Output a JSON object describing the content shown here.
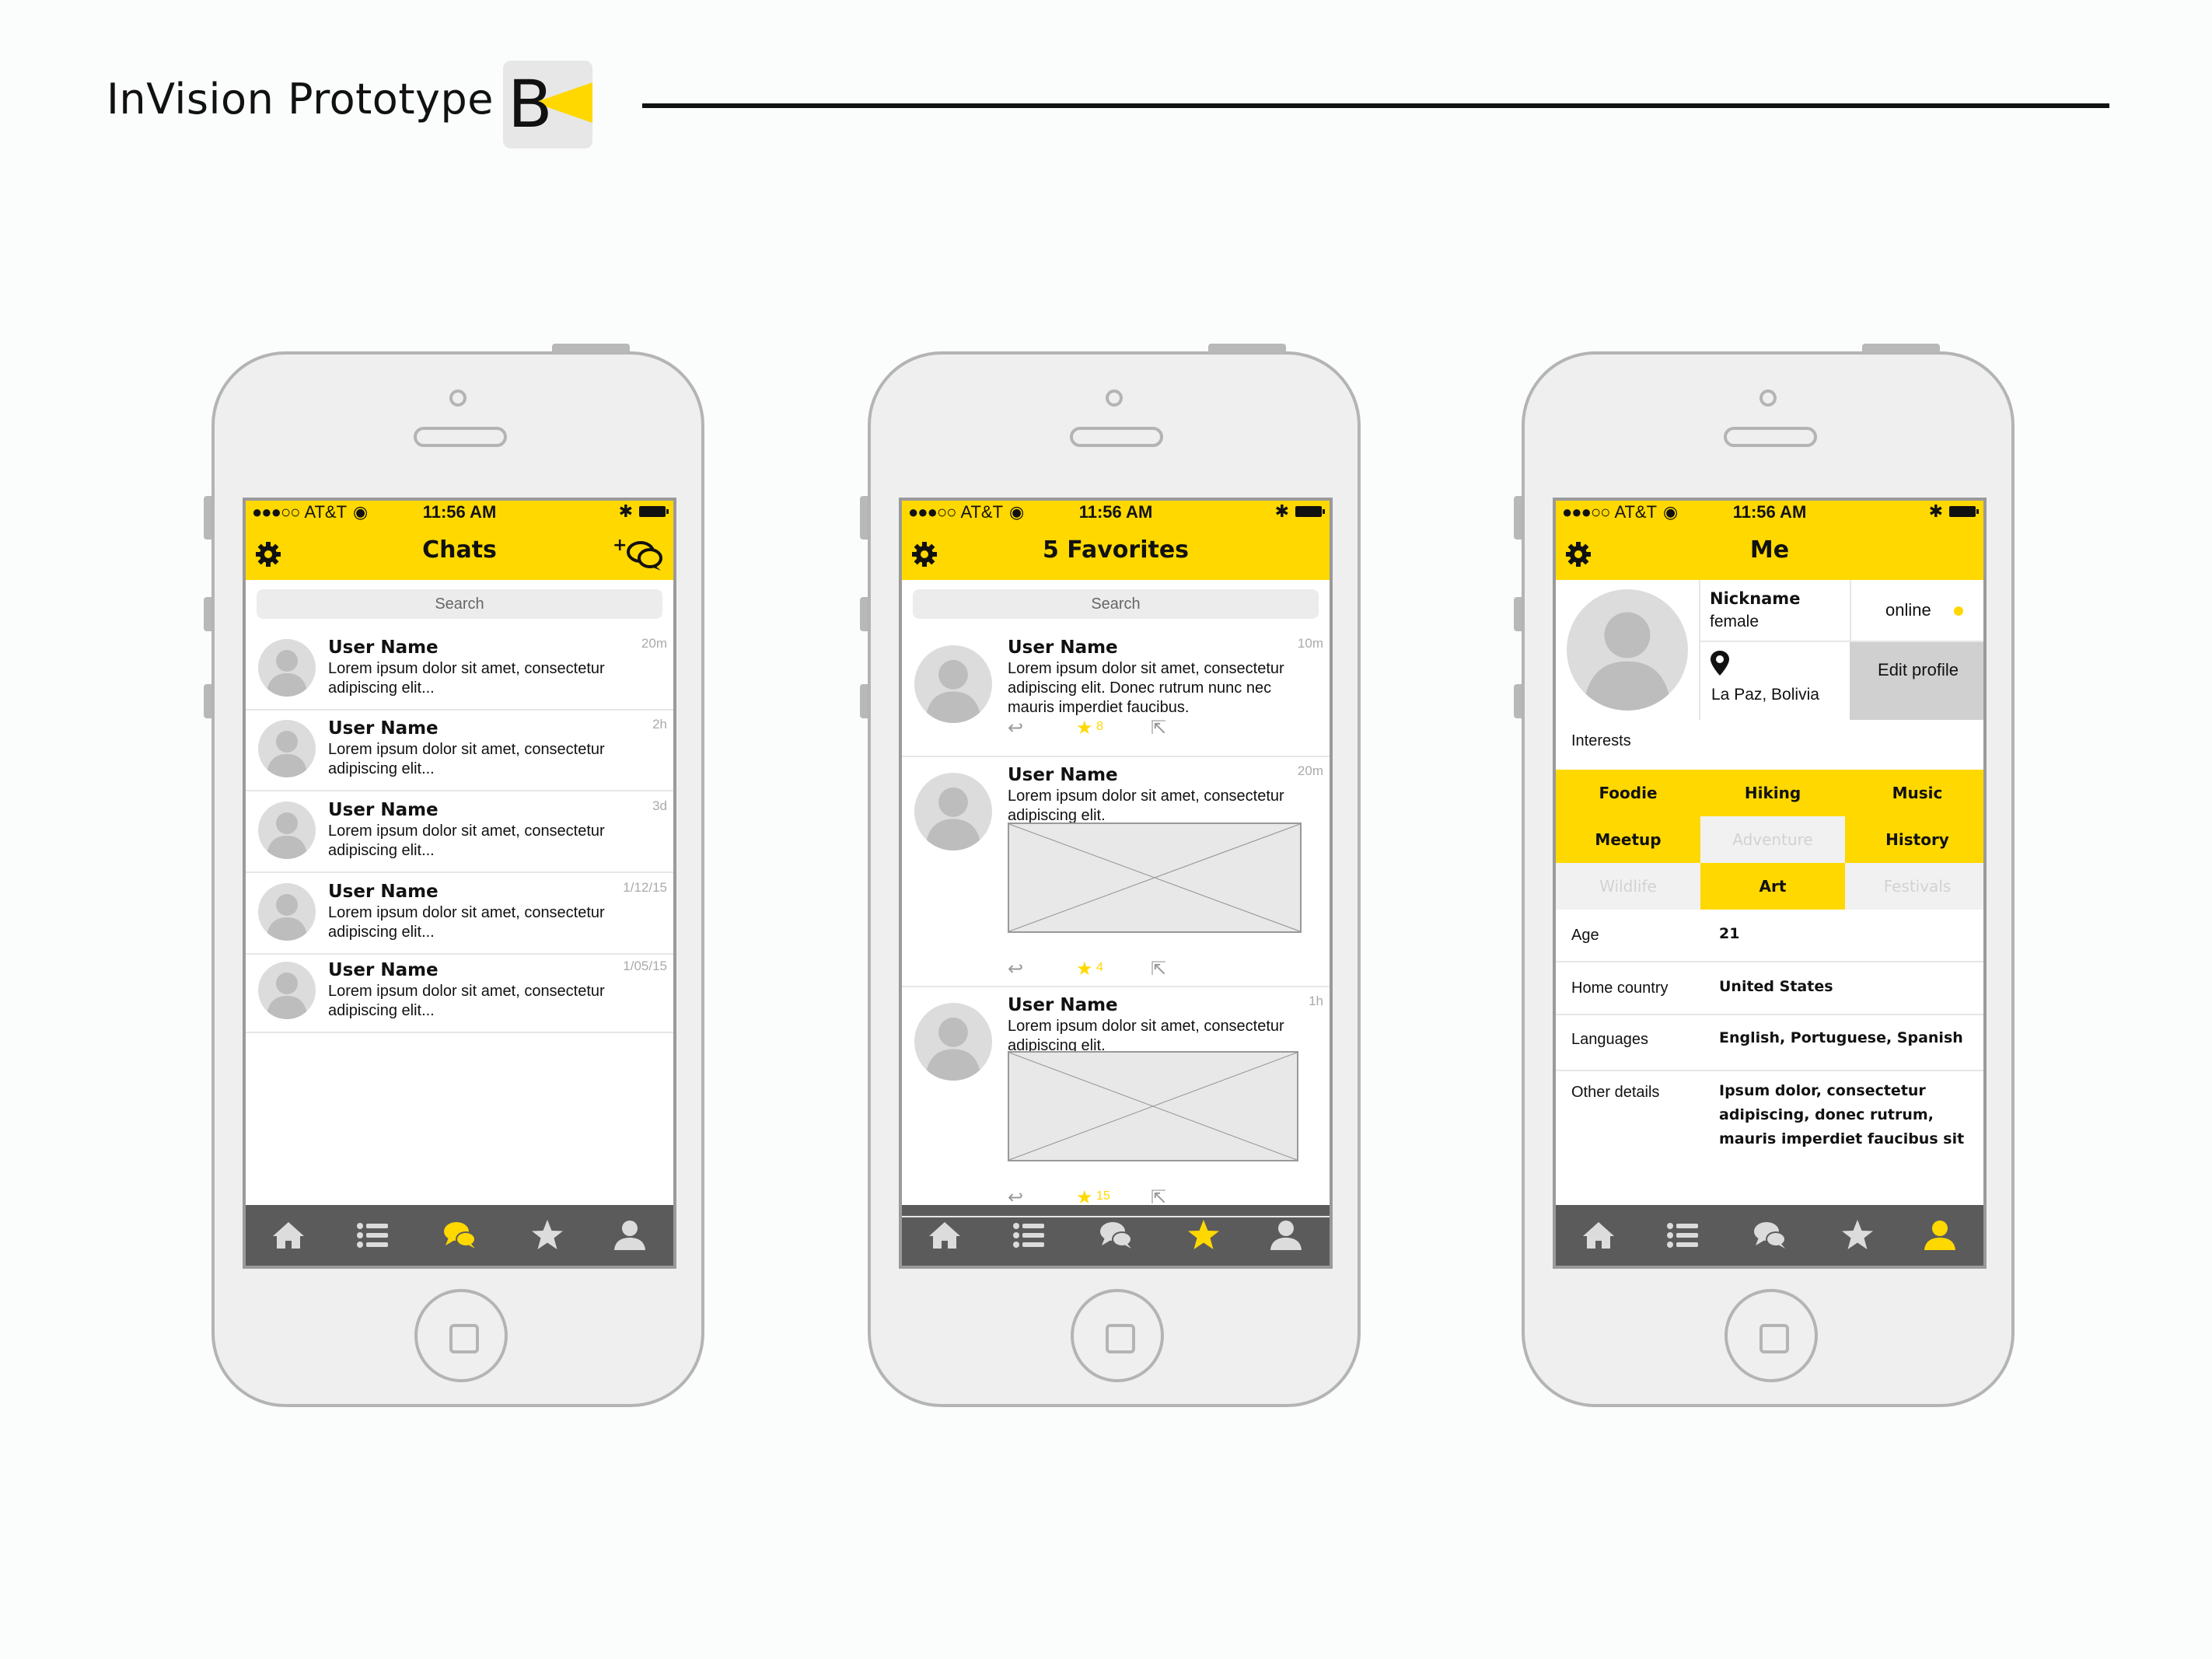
{
  "header": {
    "title": "InVision Prototype",
    "logo_letter": "B"
  },
  "colors": {
    "accent": "#ffd800",
    "tabbar": "#5b5b5b",
    "tab_inactive": "#dcdcdc"
  },
  "status": {
    "dots": "●●●○○",
    "carrier": "AT&T",
    "wifi": "◉",
    "time": "11:56 AM",
    "bluetooth": "✱"
  },
  "phones": {
    "chats": {
      "title": "Chats",
      "search": "Search",
      "rows": [
        {
          "name": "User Name",
          "text": "Lorem ipsum dolor sit amet, consectetur adipiscing elit...",
          "time": "20m"
        },
        {
          "name": "User Name",
          "text": "Lorem ipsum dolor sit amet, consectetur adipiscing elit...",
          "time": "2h"
        },
        {
          "name": "User Name",
          "text": "Lorem ipsum dolor sit amet, consectetur adipiscing elit...",
          "time": "3d"
        },
        {
          "name": "User Name",
          "text": "Lorem ipsum dolor sit amet, consectetur adipiscing elit...",
          "time": "1/12/15"
        },
        {
          "name": "User Name",
          "text": "Lorem ipsum dolor sit amet, consectetur adipiscing elit...",
          "time": "1/05/15"
        }
      ],
      "active_tab": "chats"
    },
    "favorites": {
      "title": "5 Favorites",
      "search": "Search",
      "posts": [
        {
          "name": "User Name",
          "text": "Lorem ipsum dolor sit amet, consectetur adipiscing elit. Donec rutrum nunc nec mauris imperdiet faucibus.",
          "time": "10m",
          "stars": "8"
        },
        {
          "name": "User Name",
          "text": "Lorem ipsum dolor sit amet, consectetur adipiscing elit.",
          "time": "20m",
          "stars": "4"
        },
        {
          "name": "User Name",
          "text": "Lorem ipsum dolor sit amet, consectetur adipiscing elit.",
          "time": "1h",
          "stars": "15"
        }
      ],
      "active_tab": "favorites"
    },
    "me": {
      "title": "Me",
      "nickname": "Nickname",
      "gender": "female",
      "status": "online",
      "location": "La Paz, Bolivia",
      "edit_profile": "Edit profile",
      "interests_label": "Interests",
      "interests": [
        {
          "label": "Foodie",
          "selected": true
        },
        {
          "label": "Hiking",
          "selected": true
        },
        {
          "label": "Music",
          "selected": true
        },
        {
          "label": "Meetup",
          "selected": true
        },
        {
          "label": "Adventure",
          "selected": false
        },
        {
          "label": "History",
          "selected": true
        },
        {
          "label": "Wildlife",
          "selected": false
        },
        {
          "label": "Art",
          "selected": true
        },
        {
          "label": "Festivals",
          "selected": false
        }
      ],
      "details": [
        {
          "key": "Age",
          "value": "21"
        },
        {
          "key": "Home country",
          "value": "United States"
        },
        {
          "key": "Languages",
          "value": "English, Portuguese, Spanish"
        },
        {
          "key": "Other details",
          "value": "Ipsum dolor, consectetur adipiscing, donec rutrum, mauris imperdiet faucibus sit"
        }
      ],
      "active_tab": "me"
    }
  },
  "tabs": [
    {
      "name": "home",
      "icon": "home-icon"
    },
    {
      "name": "list",
      "icon": "list-icon"
    },
    {
      "name": "chats",
      "icon": "chat-bubbles-icon"
    },
    {
      "name": "favorites",
      "icon": "star-icon"
    },
    {
      "name": "me",
      "icon": "person-icon"
    }
  ]
}
